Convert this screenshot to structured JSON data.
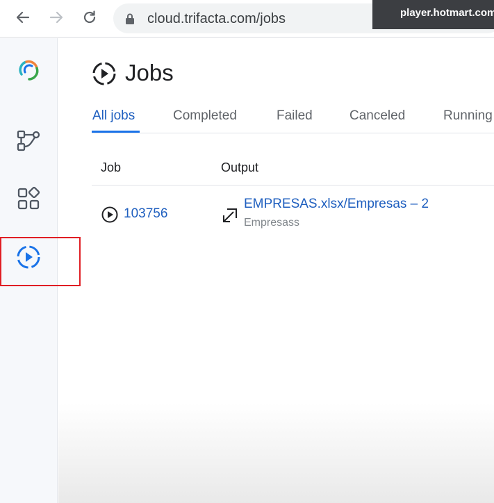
{
  "browser": {
    "url": "cloud.trifacta.com/jobs",
    "overlay_badge": "player.hotmart.com"
  },
  "sidebar": {
    "items": [
      {
        "name": "trifacta-logo-icon"
      },
      {
        "name": "flows-icon"
      },
      {
        "name": "library-icon"
      },
      {
        "name": "jobs-icon",
        "active": true
      }
    ]
  },
  "page": {
    "title": "Jobs",
    "tabs": [
      {
        "label": "All jobs",
        "active": true
      },
      {
        "label": "Completed"
      },
      {
        "label": "Failed"
      },
      {
        "label": "Canceled"
      },
      {
        "label": "Running"
      }
    ],
    "columns": {
      "job": "Job",
      "output": "Output"
    },
    "rows": [
      {
        "job_id": "103756",
        "output_name": "EMPRESAS.xlsx/Empresas – 2",
        "output_sub": "Empresass"
      }
    ]
  },
  "colors": {
    "accent": "#1a73e8",
    "link": "#1f5fbf",
    "highlight": "#e01e24",
    "sidebar_bg": "#f6f8fb"
  }
}
